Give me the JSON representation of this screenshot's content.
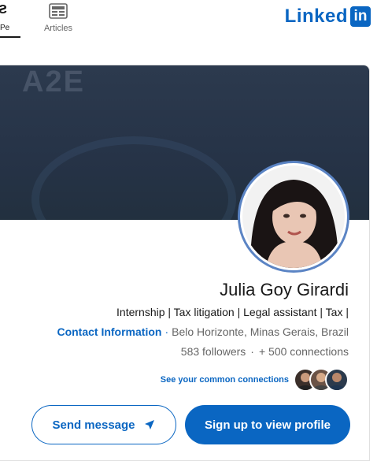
{
  "nav": {
    "people_label": "Pe",
    "articles_label": "Articles"
  },
  "logo": {
    "word": "Linked",
    "box": "in"
  },
  "banner": {
    "ghost_text": "A2E"
  },
  "profile": {
    "name": "Julia Goy Girardi",
    "headline": "Internship | Tax litigation | Legal assistant | Tax |",
    "location": "Belo Horizonte, Minas Gerais, Brazil",
    "contact_link": "Contact Information",
    "followers": "583 followers",
    "connections": "+ 500 connections",
    "common_connections": "See your common connections"
  },
  "actions": {
    "signup_label": "Sign up to view profile",
    "message_label": "Send message"
  },
  "colors": {
    "brand_blue": "#0a66c2",
    "banner": "#263347"
  }
}
